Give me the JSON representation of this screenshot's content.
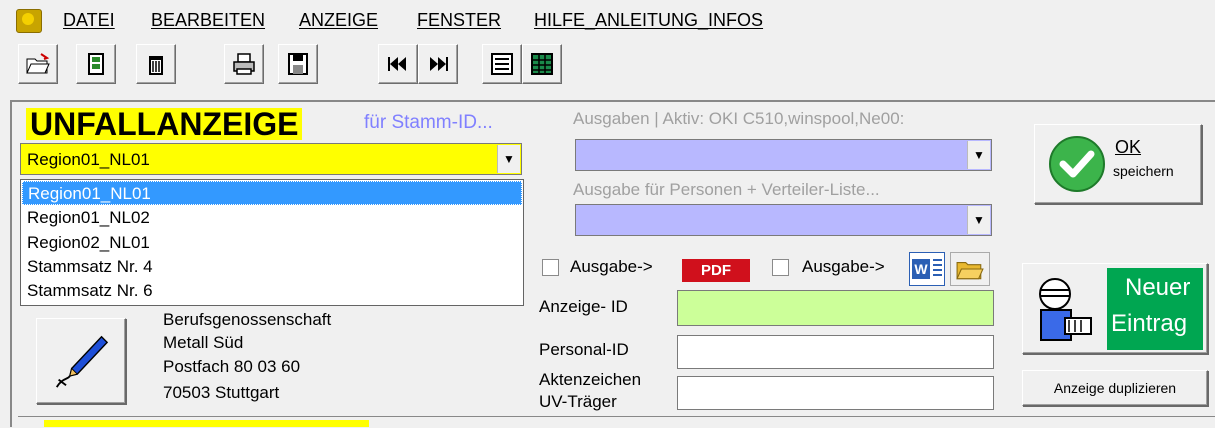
{
  "menu": {
    "items": [
      "DATEI",
      "BEARBEITEN",
      "ANZEIGE",
      "FENSTER",
      "HILFE_ANLEITUNG_INFOS"
    ]
  },
  "toolbar": {
    "buttons": [
      "open-folder-icon",
      "cabinet-icon",
      "trash-icon",
      "printer-icon",
      "save-disk-icon",
      "first-record-icon",
      "last-record-icon",
      "list-view-icon",
      "table-view-icon"
    ]
  },
  "form": {
    "title": "UNFALLANZEIGE",
    "subtitle": "für Stamm-ID...",
    "region_selected": "Region01_NL01",
    "region_options": [
      "Region01_NL01",
      "Region01_NL02",
      "Region02_NL01",
      "Stammsatz Nr. 4",
      "Stammsatz Nr. 6"
    ],
    "insurer_address": [
      "Berufsgenossenschaft",
      "Metall Süd",
      "Postfach 80 03 60",
      "70503   Stuttgart"
    ]
  },
  "output": {
    "printer_label": "Ausgaben | Aktiv:  OKI C510,winspool,Ne00:",
    "persons_label": "Ausgabe für Personen +  Verteiler-Liste...",
    "pdf_checkbox_label": "Ausgabe->",
    "pdf_badge": "PDF",
    "word_checkbox_label": "Ausgabe->",
    "word_icon_letter": "W"
  },
  "fields": {
    "anzeige_id_label": "Anzeige- ID",
    "anzeige_id_value": "",
    "personal_id_label": "Personal-ID",
    "personal_id_value": "",
    "aktenzeichen_label_line1": "Aktenzeichen",
    "aktenzeichen_label_line2": "UV-Träger",
    "aktenzeichen_value": ""
  },
  "actions": {
    "ok_label": "OK",
    "ok_sub": "speichern",
    "new_entry_line1": "Neuer",
    "new_entry_line2": "Eintrag",
    "duplicate_label": "Anzeige duplizieren"
  },
  "colors": {
    "accent_yellow": "#ffff00",
    "lavender": "#b8b8ff",
    "green_field": "#ccff99",
    "new_entry_green": "#00a651",
    "selection_blue": "#3399ff"
  }
}
